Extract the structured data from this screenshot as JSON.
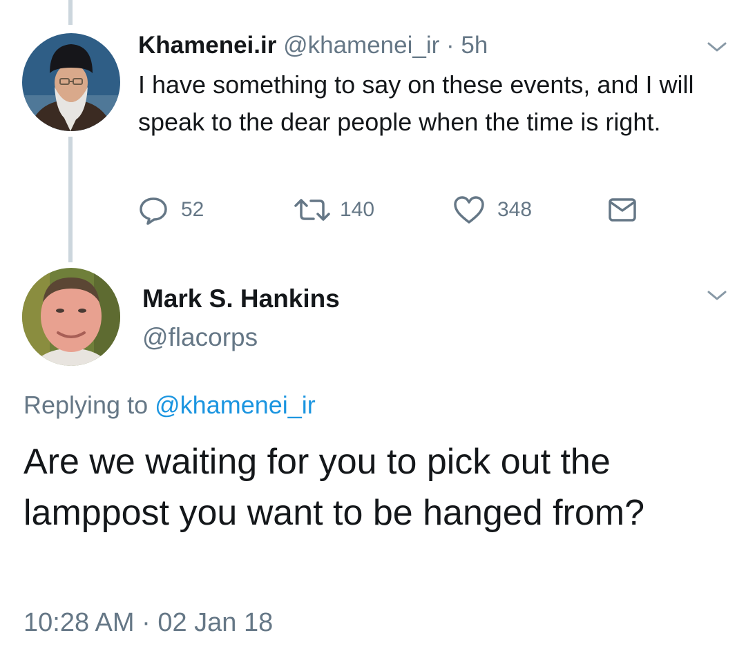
{
  "colors": {
    "text_primary": "#14171a",
    "text_secondary": "#657786",
    "link": "#1b95e0",
    "thread_line": "#ccd6dd"
  },
  "parent_tweet": {
    "display_name": "Khamenei.ir",
    "handle": "@khamenei_ir",
    "separator": "·",
    "time": "5h",
    "text": "I have something to say on these events, and I will speak to the dear people when the time is right.",
    "avatar_icon": "user-avatar-photo",
    "menu_icon": "chevron-down-icon",
    "actions": {
      "reply": {
        "icon": "reply-icon",
        "count": "52"
      },
      "retweet": {
        "icon": "retweet-icon",
        "count": "140"
      },
      "like": {
        "icon": "heart-icon",
        "count": "348"
      },
      "dm": {
        "icon": "envelope-icon"
      }
    }
  },
  "reply_tweet": {
    "display_name": "Mark S. Hankins",
    "handle": "@flacorps",
    "avatar_icon": "user-avatar-photo",
    "menu_icon": "chevron-down-icon",
    "replying_prefix": "Replying to",
    "replying_handle": "@khamenei_ir",
    "text": "Are we waiting for you to pick out the lamppost you want to be hanged from?",
    "timestamp": "10:28 AM · 02 Jan 18"
  }
}
